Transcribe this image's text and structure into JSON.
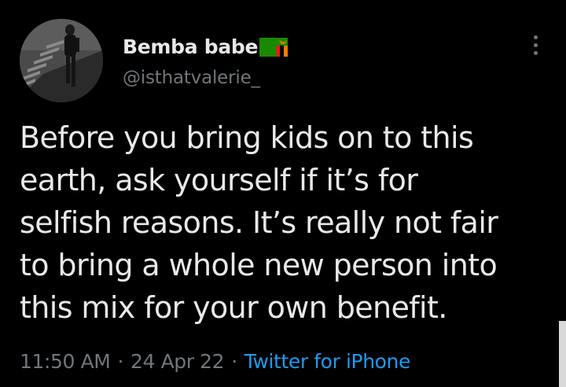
{
  "tweet": {
    "author": {
      "display_name": "Bemba babe",
      "handle": "@isthatvalerie_",
      "avatar_icon": "profile-photo",
      "flag_icon": "zambia-flag-icon"
    },
    "text_lines": [
      "Before you bring kids on to this",
      "earth, ask yourself if it’s for",
      "selfish reasons. It’s really not fair",
      "to bring a whole new person into",
      "this mix for your own benefit."
    ],
    "time": "11:50 AM",
    "date": "24 Apr 22",
    "separator": "·",
    "source": "Twitter for iPhone",
    "more_icon": "more-options-icon"
  },
  "colors": {
    "background": "#000000",
    "text_primary": "#e7e9ea",
    "text_muted": "#71767b",
    "link": "#1d9bf0"
  }
}
